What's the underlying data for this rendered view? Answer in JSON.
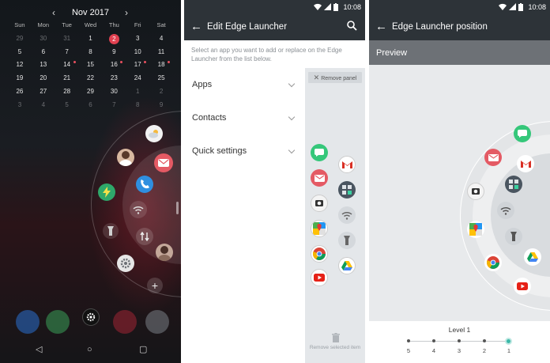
{
  "home": {
    "calendar": {
      "month": "Nov 2017",
      "prev_glyph": "‹",
      "next_glyph": "›",
      "weekdays": [
        "Sun",
        "Mon",
        "Tue",
        "Wed",
        "Thu",
        "Fri",
        "Sat"
      ],
      "weeks": [
        [
          "29",
          "30",
          "31",
          "1",
          "2",
          "3",
          "4"
        ],
        [
          "5",
          "6",
          "7",
          "8",
          "9",
          "10",
          "11"
        ],
        [
          "12",
          "13",
          "14",
          "15",
          "16",
          "17",
          "18"
        ],
        [
          "19",
          "20",
          "21",
          "22",
          "23",
          "24",
          "25"
        ],
        [
          "26",
          "27",
          "28",
          "29",
          "30",
          "1",
          "2"
        ],
        [
          "3",
          "4",
          "5",
          "6",
          "7",
          "8",
          "9"
        ]
      ],
      "today": "2",
      "accent_color": "#e04050"
    },
    "nav": {
      "back": "◁",
      "home": "○",
      "recents": "▢"
    },
    "add_glyph": "+"
  },
  "edit": {
    "status_time": "10:08",
    "title": "Edit Edge Launcher",
    "info": "Select an app you want to add or replace on the Edge Launcher from the list below.",
    "sections": [
      {
        "label": "Apps"
      },
      {
        "label": "Contacts"
      },
      {
        "label": "Quick settings"
      }
    ],
    "remove_panel": "Remove panel",
    "remove_selected": "Remove selected item"
  },
  "position": {
    "status_time": "10:08",
    "title": "Edge Launcher position",
    "preview": "Preview",
    "level_label": "Level 1",
    "levels": [
      "5",
      "4",
      "3",
      "2",
      "1"
    ],
    "selected_level": "1",
    "accent_color": "#3bb8a8"
  },
  "colors": {
    "appbar": "#2d3338",
    "preview_bar": "#6d7176",
    "panel_bg": "#e4e7ea"
  }
}
